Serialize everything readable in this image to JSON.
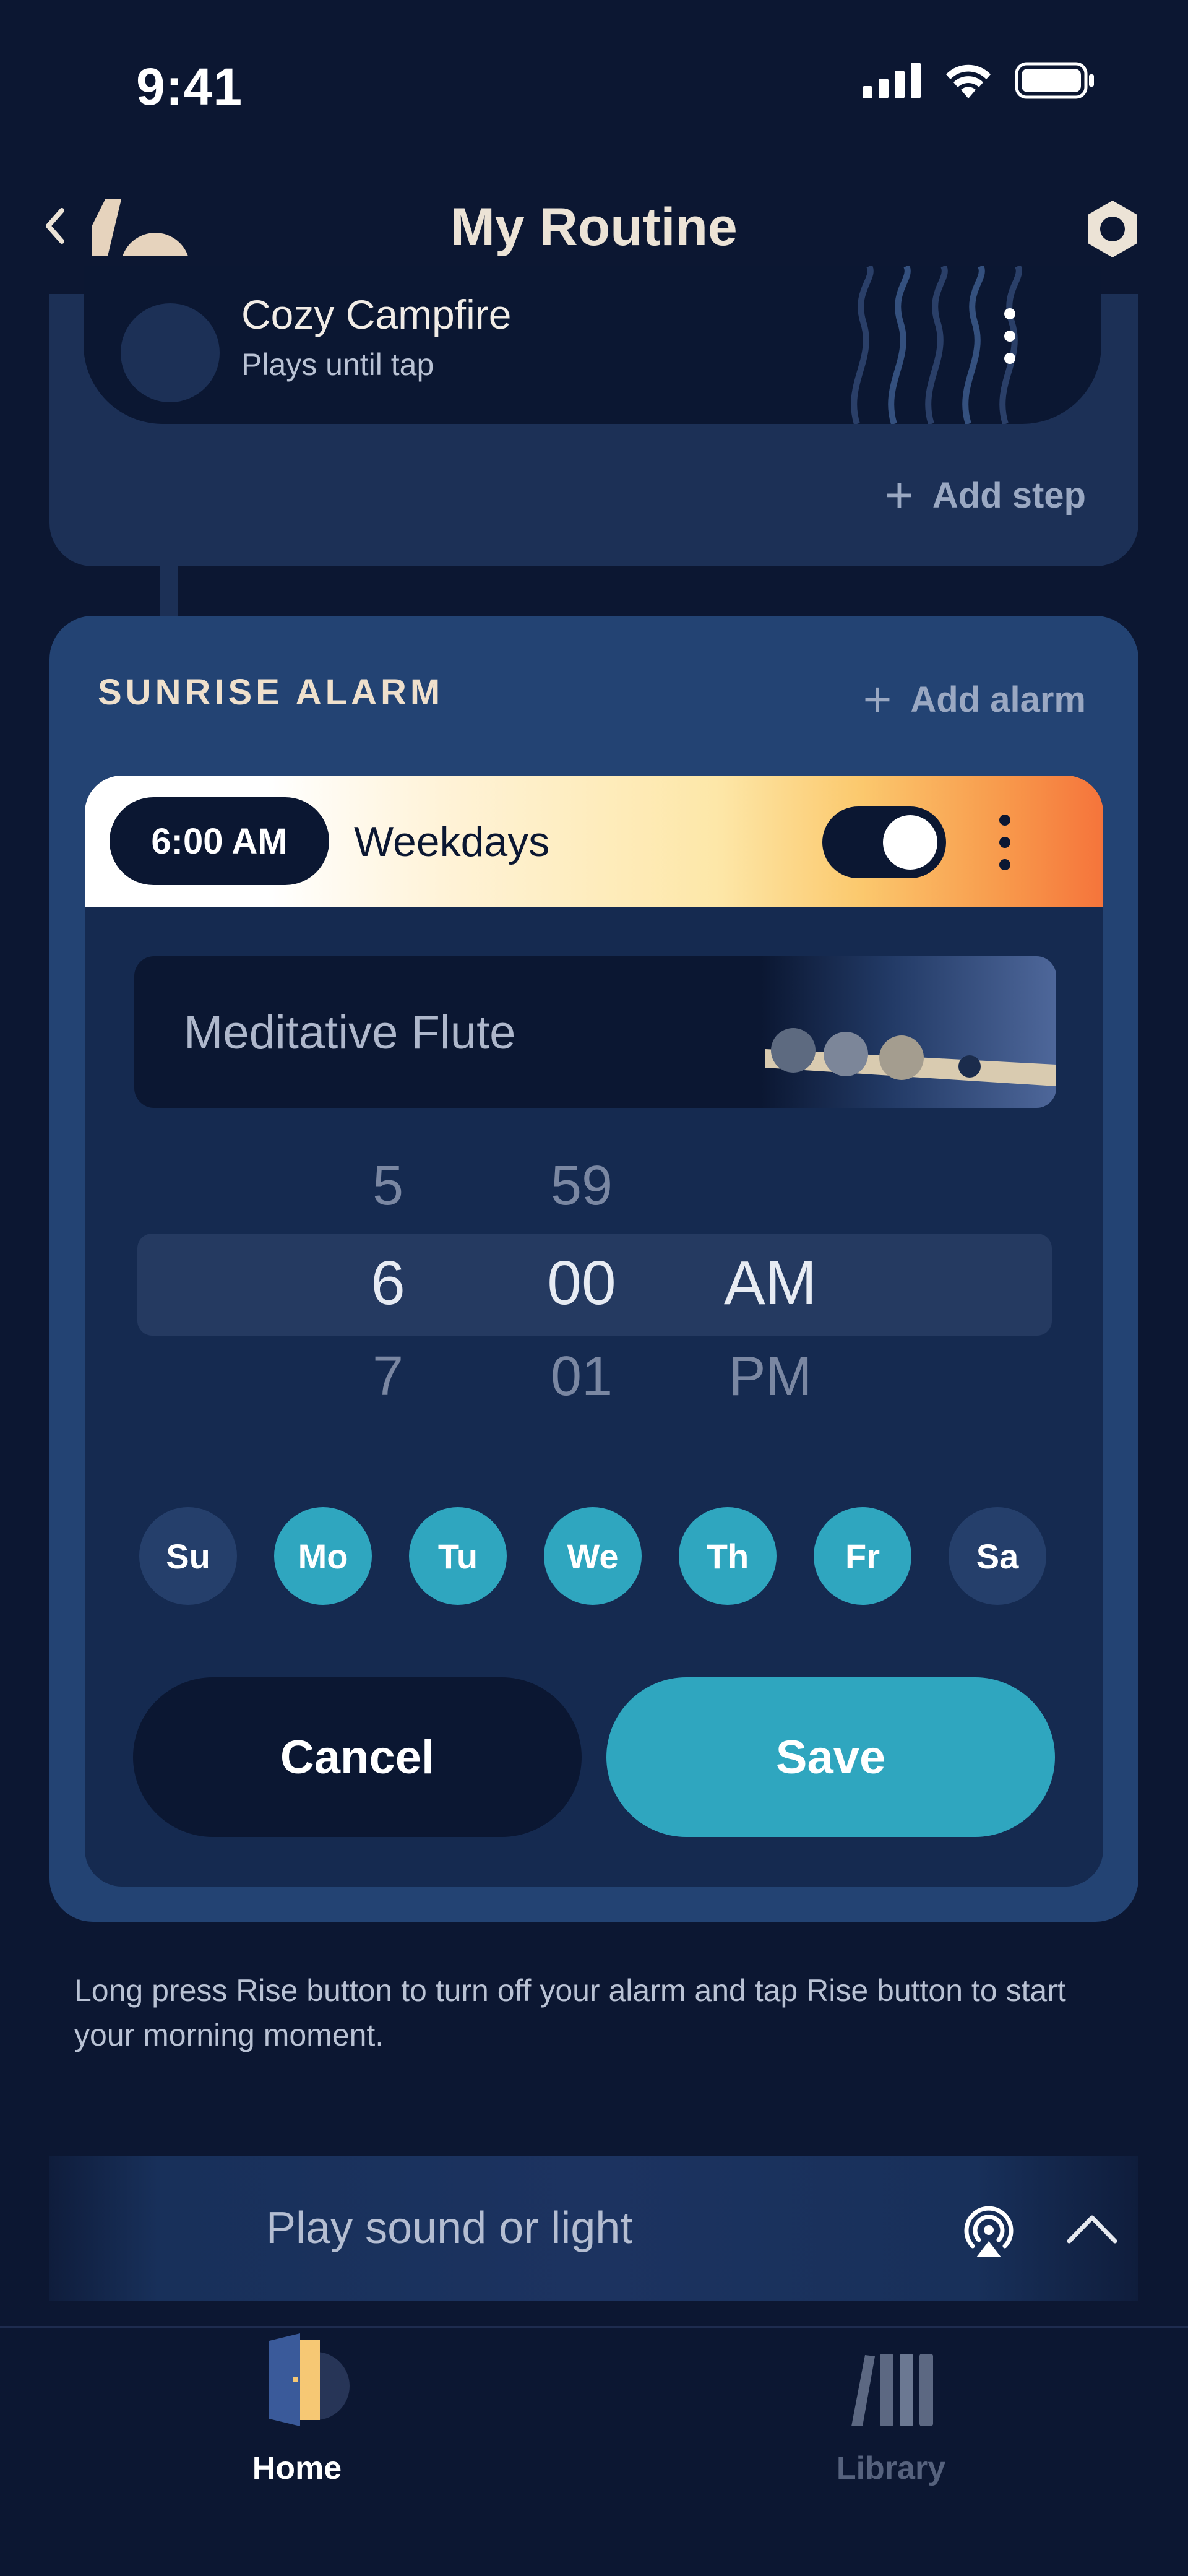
{
  "status_bar": {
    "time": "9:41"
  },
  "header": {
    "title": "My Routine",
    "back_icon": "chevron-left-icon",
    "logo_icon": "sunrise-logo-icon",
    "settings_icon": "hexagon-settings-icon"
  },
  "previous_step": {
    "title": "Cozy Campfire",
    "subtitle": "Plays until tap",
    "add_step_label": "Add step"
  },
  "sunrise_alarm": {
    "section_label": "SUNRISE ALARM",
    "add_alarm_label": "Add alarm",
    "alarm": {
      "time": "6:00 AM",
      "repeat": "Weekdays",
      "enabled": true,
      "sound": "Meditative Flute"
    },
    "picker": {
      "hours": {
        "prev": "5",
        "selected": "6",
        "next": "7"
      },
      "minutes": {
        "prev": "59",
        "selected": "00",
        "next": "01"
      },
      "period": {
        "prev": "",
        "selected": "AM",
        "next": "PM"
      }
    },
    "days": [
      {
        "label": "Su",
        "selected": false
      },
      {
        "label": "Mo",
        "selected": true
      },
      {
        "label": "Tu",
        "selected": true
      },
      {
        "label": "We",
        "selected": true
      },
      {
        "label": "Th",
        "selected": true
      },
      {
        "label": "Fr",
        "selected": true
      },
      {
        "label": "Sa",
        "selected": false
      }
    ],
    "cancel_label": "Cancel",
    "save_label": "Save"
  },
  "help_text": "Long press Rise button to turn off your alarm and tap Rise button to start your morning moment.",
  "player": {
    "label": "Play sound or light",
    "cast_icon": "airplay-icon",
    "expand_icon": "chevron-up-icon"
  },
  "tabs": [
    {
      "label": "Home",
      "icon": "door-icon",
      "active": true
    },
    {
      "label": "Library",
      "icon": "books-icon",
      "active": false
    }
  ],
  "colors": {
    "background": "#0c1732",
    "card": "#234373",
    "accent": "#2fa6bf",
    "header_title": "#ece3d6"
  }
}
